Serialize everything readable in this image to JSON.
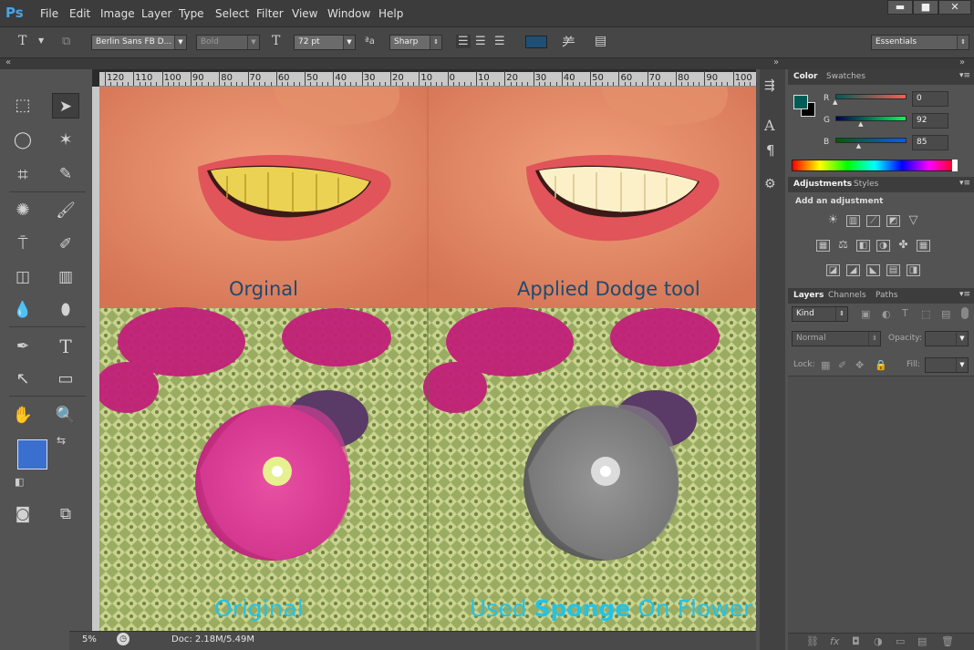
{
  "app": {
    "logo": "Ps"
  },
  "menu": [
    "File",
    "Edit",
    "Image",
    "Layer",
    "Type",
    "Select",
    "Filter",
    "View",
    "Window",
    "Help"
  ],
  "window_buttons": [
    "▬",
    "■",
    "✕"
  ],
  "options": {
    "font_family": "Berlin Sans FB D...",
    "font_style": "Bold",
    "font_size": "72 pt",
    "antialias": "Sharp",
    "workspace": "Essentials",
    "text_color": "#1f4f75"
  },
  "ruler_labels": [
    "120",
    "110",
    "100",
    "90",
    "80",
    "70",
    "60",
    "50",
    "40",
    "30",
    "20",
    "10",
    "0",
    "10",
    "20",
    "30",
    "40",
    "50",
    "60",
    "70",
    "80",
    "90",
    "100"
  ],
  "captions": {
    "top_left": "Orginal",
    "top_right": "Applied Dodge tool",
    "bottom_left": "Original",
    "bottom_right_pre": "Used ",
    "bottom_right_bold": "Sponge",
    "bottom_right_post": " On Flower"
  },
  "status": {
    "zoom": "5%",
    "doc": "Doc: 2.18M/5.49M"
  },
  "color_panel": {
    "tabs": [
      "Color",
      "Swatches"
    ],
    "channels": [
      {
        "name": "R",
        "value": "0",
        "fraction": 0.0
      },
      {
        "name": "G",
        "value": "92",
        "fraction": 0.36
      },
      {
        "name": "B",
        "value": "85",
        "fraction": 0.33
      }
    ],
    "foreground": "#005c55",
    "background": "#000000"
  },
  "adjustments_panel": {
    "tabs": [
      "Adjustments",
      "Styles"
    ],
    "heading": "Add an adjustment"
  },
  "layers_panel": {
    "tabs": [
      "Layers",
      "Channels",
      "Paths"
    ],
    "kind": "Kind",
    "blend_mode": "Normal",
    "opacity_label": "Opacity:",
    "lock_label": "Lock:",
    "fill_label": "Fill:"
  },
  "toolbox_colors": {
    "foreground": "#3a6fd0",
    "background": "#000000"
  }
}
